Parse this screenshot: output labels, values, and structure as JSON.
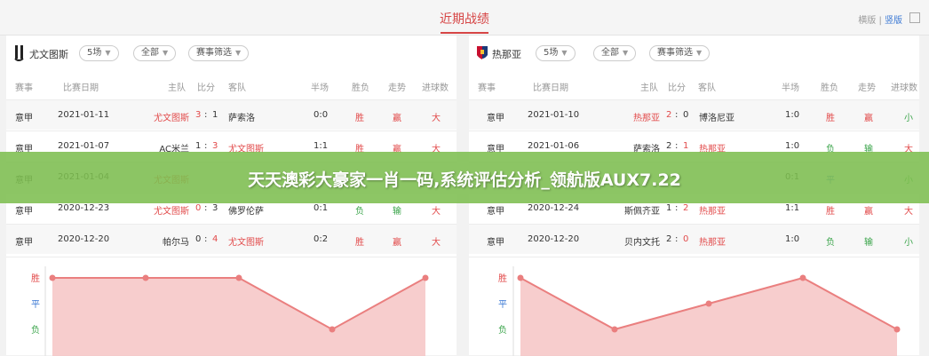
{
  "header": {
    "title": "近期战绩",
    "switch_a": "横版",
    "switch_sep": "|",
    "switch_b": "竖版"
  },
  "columns": [
    "赛事",
    "比赛日期",
    "主队",
    "比分",
    "客队",
    "半场",
    "胜负",
    "走势",
    "进球数"
  ],
  "panels": [
    {
      "team": "尤文图斯",
      "filter_count": "5场",
      "filter_all": "全部",
      "filter_league": "赛事筛选",
      "rows": [
        {
          "league": "意甲",
          "date": "2021-01-11",
          "home": "尤文图斯",
          "hs": "3",
          "colon": ":",
          "as": "1",
          "away": "萨索洛",
          "half": "0:0",
          "result": "胜",
          "trend": "赢",
          "goals": "大"
        },
        {
          "league": "意甲",
          "date": "2021-01-07",
          "home": "AC米兰",
          "hs": "1",
          "colon": ":",
          "as": "3",
          "away": "尤文图斯",
          "half": "1:1",
          "result": "胜",
          "trend": "赢",
          "goals": "大"
        },
        {
          "league": "意甲",
          "date": "2021-01-04",
          "home": "尤文图斯",
          "hs": "",
          "colon": "",
          "as": "",
          "away": "",
          "half": "",
          "result": "",
          "trend": "",
          "goals": ""
        },
        {
          "league": "意甲",
          "date": "2020-12-23",
          "home": "尤文图斯",
          "hs": "0",
          "colon": ":",
          "as": "3",
          "away": "佛罗伦萨",
          "half": "0:1",
          "result": "负",
          "trend": "输",
          "goals": "大"
        },
        {
          "league": "意甲",
          "date": "2020-12-20",
          "home": "帕尔马",
          "hs": "0",
          "colon": ":",
          "as": "4",
          "away": "尤文图斯",
          "half": "0:2",
          "result": "胜",
          "trend": "赢",
          "goals": "大"
        }
      ],
      "chart_axis": [
        "胜",
        "平",
        "负"
      ],
      "chart_data": {
        "type": "area",
        "series": [
          {
            "values": [
              3,
              3,
              3,
              1,
              3
            ]
          }
        ],
        "ylim": [
          0,
          3
        ]
      }
    },
    {
      "team": "热那亚",
      "filter_count": "5场",
      "filter_all": "全部",
      "filter_league": "赛事筛选",
      "rows": [
        {
          "league": "意甲",
          "date": "2021-01-10",
          "home": "热那亚",
          "hs": "2",
          "colon": ":",
          "as": "0",
          "away": "博洛尼亚",
          "half": "1:0",
          "result": "胜",
          "trend": "赢",
          "goals": "小"
        },
        {
          "league": "意甲",
          "date": "2021-01-06",
          "home": "萨索洛",
          "hs": "2",
          "colon": ":",
          "as": "1",
          "away": "热那亚",
          "half": "1:0",
          "result": "负",
          "trend": "输",
          "goals": "大"
        },
        {
          "league": "意甲",
          "date": "",
          "home": "",
          "hs": "",
          "colon": "",
          "as": "",
          "away": "",
          "half": "0:1",
          "result": "平",
          "trend": "",
          "goals": "小"
        },
        {
          "league": "意甲",
          "date": "2020-12-24",
          "home": "斯佩齐亚",
          "hs": "1",
          "colon": ":",
          "as": "2",
          "away": "热那亚",
          "half": "1:1",
          "result": "胜",
          "trend": "赢",
          "goals": "大"
        },
        {
          "league": "意甲",
          "date": "2020-12-20",
          "home": "贝内文托",
          "hs": "2",
          "colon": ":",
          "as": "0",
          "away": "热那亚",
          "half": "1:0",
          "result": "负",
          "trend": "输",
          "goals": "小"
        }
      ],
      "chart_axis": [
        "胜",
        "平",
        "负"
      ],
      "chart_data": {
        "type": "area",
        "series": [
          {
            "values": [
              3,
              1,
              2,
              3,
              1
            ]
          }
        ],
        "ylim": [
          0,
          3
        ]
      }
    }
  ],
  "overlay": {
    "text": "天天澳彩大豪家一肖一码,系统评估分析_领航版AUX7.22"
  },
  "colors": {
    "win": "#e24b4b",
    "draw": "#3a78d4",
    "loss": "#3aa44a",
    "accent": "#d64545",
    "banner": "#7dbe50",
    "area_fill": "#f6c4c4",
    "area_line": "#ea7f7f"
  },
  "icons": {
    "left_logo": "juventus-logo-icon",
    "right_logo": "genoa-logo-icon",
    "dropdown": "chevron-down-icon"
  }
}
